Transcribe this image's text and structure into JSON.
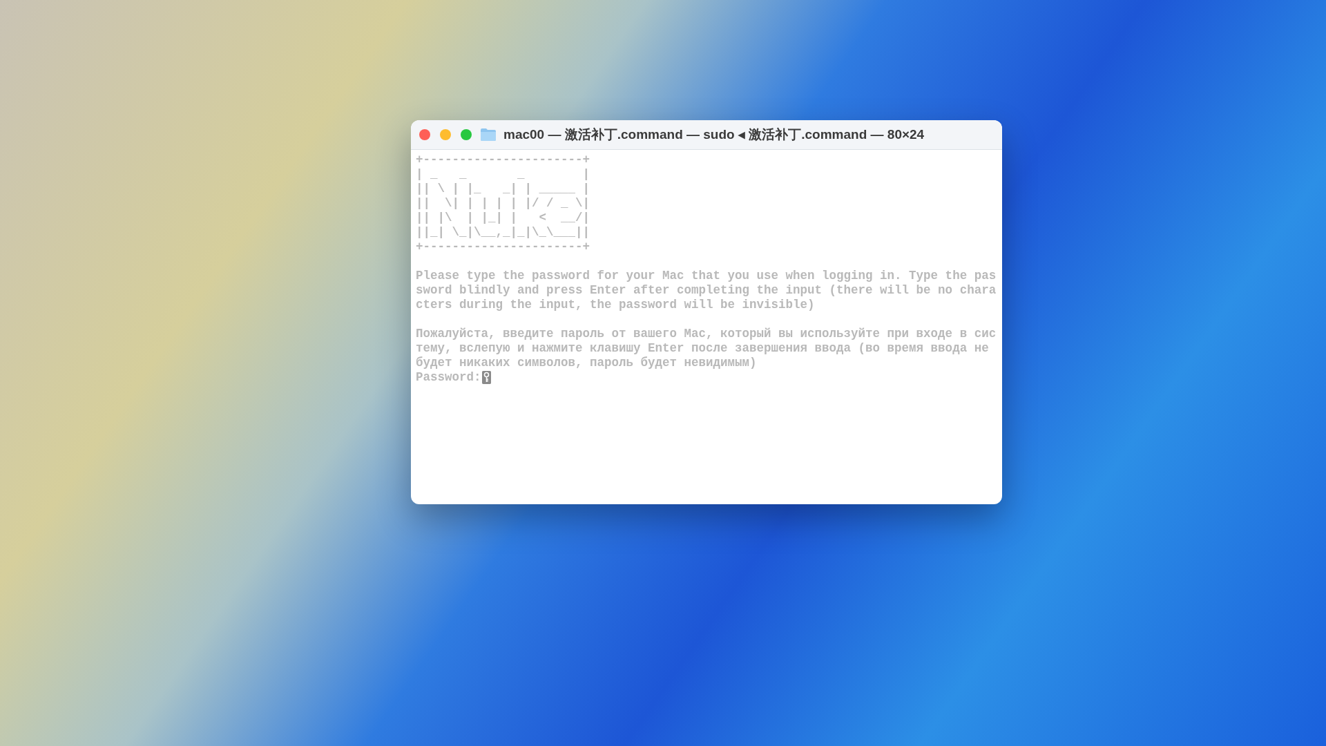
{
  "window": {
    "title": "mac00 — 激活补丁.command — sudo ◂ 激活补丁.command — 80×24"
  },
  "terminal": {
    "banner": [
      "+----------------------+",
      "| _   _       _        |",
      "|| \\ | |_   _| | _____ |",
      "||  \\| | | | | |/ / _ \\|",
      "|| |\\  | |_| |   <  __/|",
      "||_| \\_|\\__,_|_|\\_\\___||",
      "+----------------------+"
    ],
    "paragraphs": [
      [
        "Please type the password for your Mac that you use when logging in. Type the pas",
        "sword blindly and press Enter after completing the input (there will be no chara",
        "cters during the input, the password will be invisible)"
      ],
      [
        "Пожалуйста, введите пароль от вашего Mac, который вы используйте при входе в сис",
        "тему, вслепую и нажмите клавишу Enter после завершения ввода (во время ввода не",
        "будет никаких символов, пароль будет невидимым)"
      ]
    ],
    "prompt": "Password:"
  }
}
